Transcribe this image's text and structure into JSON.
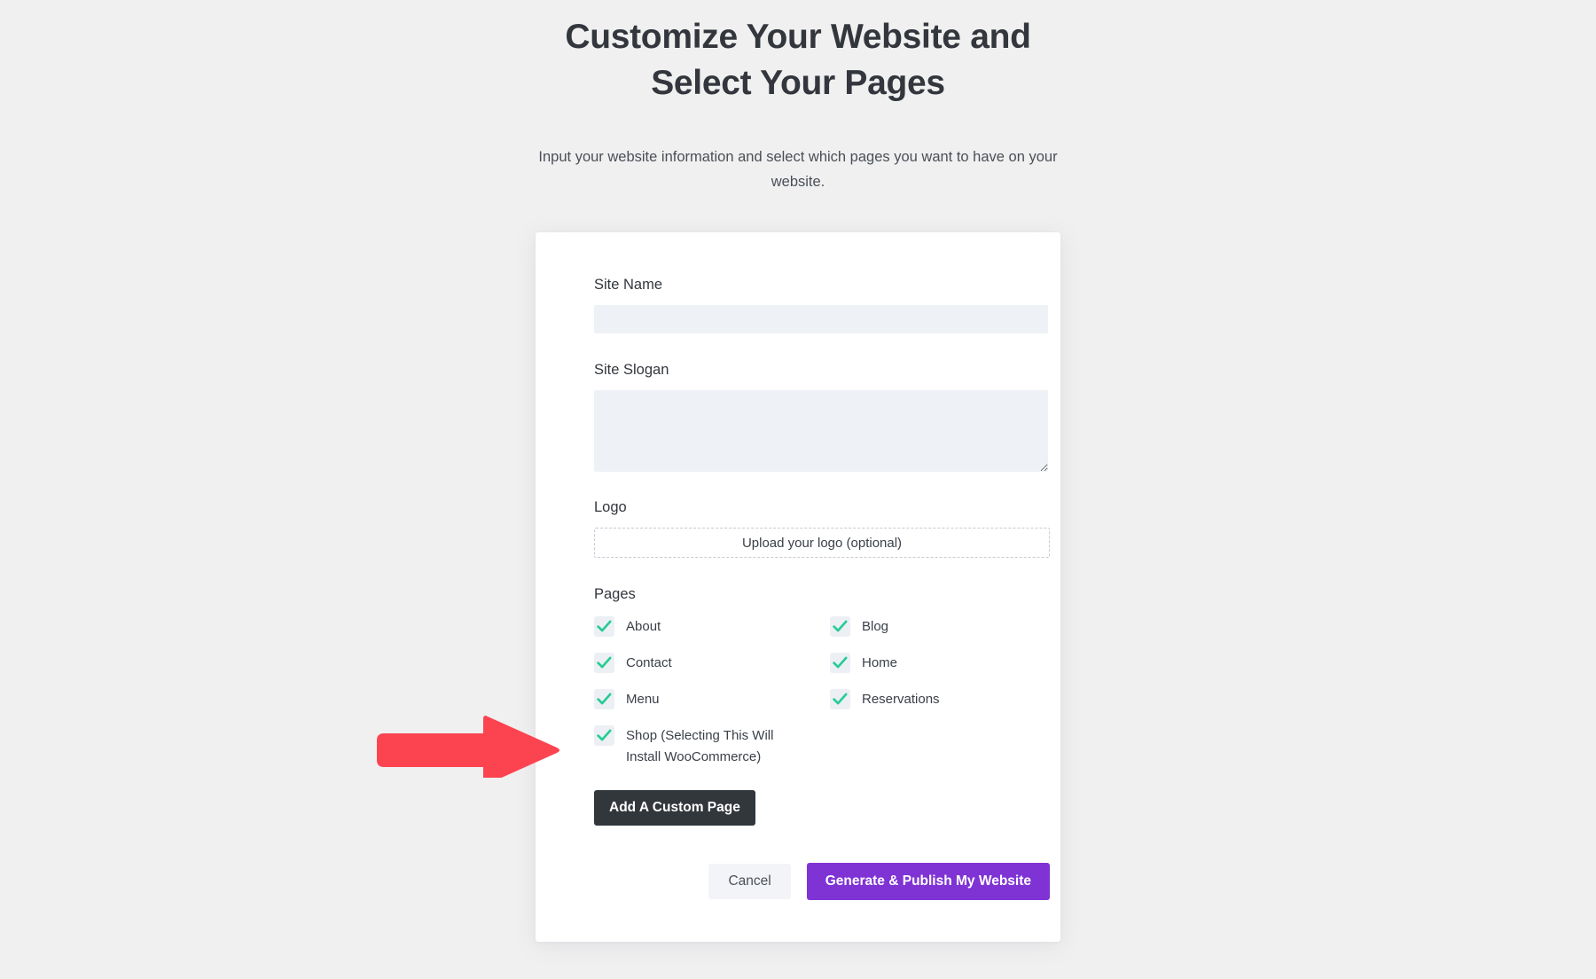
{
  "header": {
    "title": "Customize Your Website and Select Your Pages",
    "subtitle": "Input your website information and select which pages you want to have on your website."
  },
  "form": {
    "site_name": {
      "label": "Site Name",
      "value": "",
      "placeholder": ""
    },
    "site_slogan": {
      "label": "Site Slogan",
      "value": "",
      "placeholder": ""
    },
    "logo": {
      "label": "Logo",
      "upload_text": "Upload your logo (optional)"
    },
    "pages": {
      "label": "Pages",
      "rows": [
        {
          "left": {
            "label": "About",
            "checked": true
          },
          "right": {
            "label": "Blog",
            "checked": true
          }
        },
        {
          "left": {
            "label": "Contact",
            "checked": true
          },
          "right": {
            "label": "Home",
            "checked": true
          }
        },
        {
          "left": {
            "label": "Menu",
            "checked": true
          },
          "right": {
            "label": "Reservations",
            "checked": true
          }
        },
        {
          "left": {
            "label": "Shop (Selecting This Will Install WooCommerce)",
            "checked": true
          },
          "right": null
        }
      ]
    },
    "add_custom_page_label": "Add A Custom Page"
  },
  "actions": {
    "cancel_label": "Cancel",
    "publish_label": "Generate & Publish My Website"
  },
  "annotation": {
    "type": "arrow-right",
    "points_to": "Shop (Selecting This Will Install WooCommerce)",
    "color": "#fc4450"
  },
  "colors": {
    "background": "#f0f0f0",
    "card": "#ffffff",
    "input_background": "#eef1f5",
    "checkbox_background": "#eceff4",
    "checkmark": "#25cc92",
    "dark_button": "#32373c",
    "accent_purple": "#7f33d4",
    "cancel_button": "#f3f4f7",
    "arrow_red": "#fc4450",
    "text_primary": "#33373d",
    "text_secondary": "#3b4048"
  }
}
